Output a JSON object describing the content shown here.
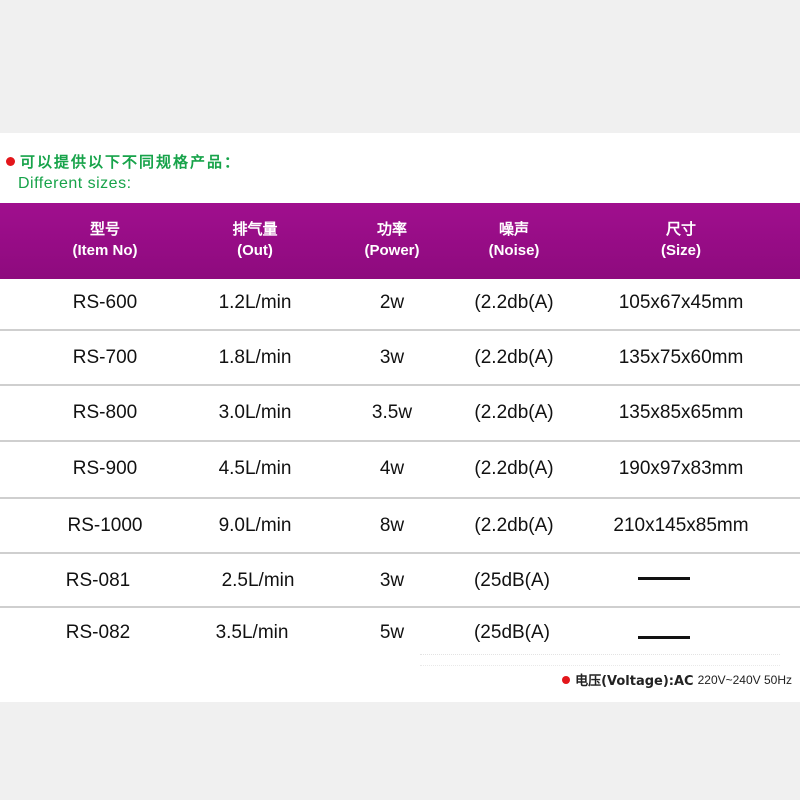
{
  "heading": {
    "cn": "可以提供以下不同规格产品：",
    "en": "Different sizes:"
  },
  "columns": [
    {
      "cn": "型号",
      "en": "(Item No)"
    },
    {
      "cn": "排气量",
      "en": "(Out)"
    },
    {
      "cn": "功率",
      "en": "(Power)"
    },
    {
      "cn": "噪声",
      "en": "(Noise)"
    },
    {
      "cn": "尺寸",
      "en": "(Size)"
    }
  ],
  "rows": [
    {
      "item": "RS-600",
      "out": "1.2L/min",
      "power": "2w",
      "noise": "(2.2db(A)",
      "size": "105x67x45mm"
    },
    {
      "item": "RS-700",
      "out": "1.8L/min",
      "power": "3w",
      "noise": "(2.2db(A)",
      "size": "135x75x60mm"
    },
    {
      "item": "RS-800",
      "out": "3.0L/min",
      "power": "3.5w",
      "noise": "(2.2db(A)",
      "size": "135x85x65mm"
    },
    {
      "item": "RS-900",
      "out": "4.5L/min",
      "power": "4w",
      "noise": "(2.2db(A)",
      "size": "190x97x83mm"
    },
    {
      "item": "RS-1000",
      "out": "9.0L/min",
      "power": "8w",
      "noise": "(2.2db(A)",
      "size": "210x145x85mm"
    },
    {
      "item": "RS-081",
      "out": "2.5L/min",
      "power": "3w",
      "noise": "(25dB(A)",
      "size": ""
    },
    {
      "item": "RS-082",
      "out": "3.5L/min",
      "power": "5w",
      "noise": "(25dB(A)",
      "size": ""
    }
  ],
  "footer": {
    "label": "电压(Voltage):AC",
    "value": "220V~240V 50Hz"
  },
  "colors": {
    "header_bar": "#960c86",
    "heading_text": "#17a34a",
    "bullet": "#e3161b"
  }
}
